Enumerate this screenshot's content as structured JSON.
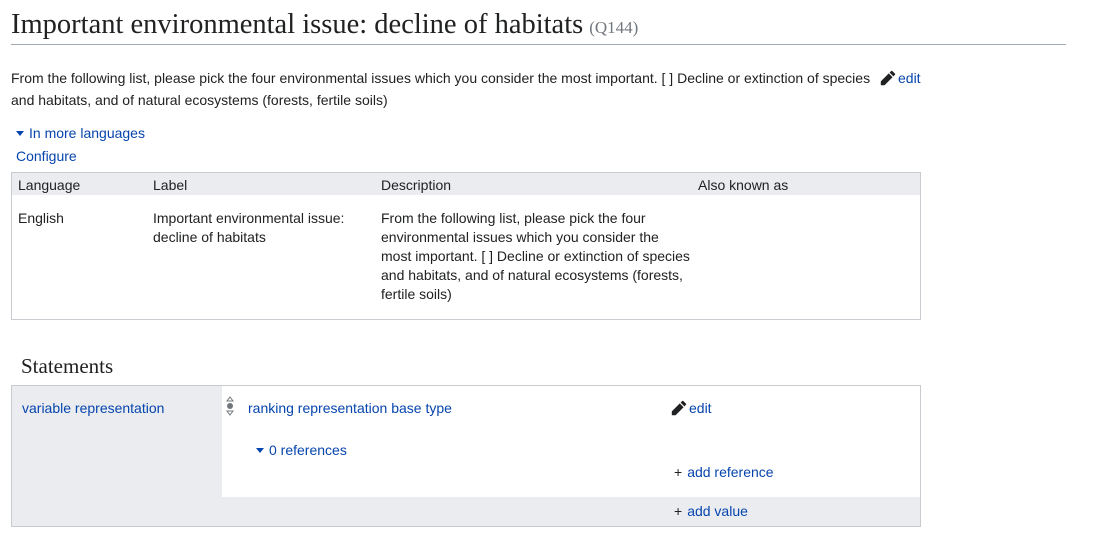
{
  "header": {
    "title": "Important environmental issue: decline of habitats",
    "id": "(Q144)"
  },
  "description": {
    "text": "From the following list, please pick the four environmental issues which you consider the most important. [ ] Decline or extinction of species and habitats, and of natural ecosystems (forests, fertile soils)",
    "edit_label": "edit"
  },
  "languages": {
    "toggle_label": "In more languages",
    "configure_label": "Configure",
    "columns": [
      "Language",
      "Label",
      "Description",
      "Also known as"
    ],
    "rows": [
      {
        "language": "English",
        "label": "Important environmental issue: decline of habitats",
        "description": "From the following list, please pick the four environmental issues which you consider the most important. [ ] Decline or extinction of species and habitats, and of natural ecosystems (forests, fertile soils)",
        "aliases": ""
      }
    ]
  },
  "statements": {
    "heading": "Statements",
    "items": [
      {
        "property": "variable representation",
        "value": "ranking representation base type",
        "edit_label": "edit",
        "references_label": "0 references",
        "add_reference_label": "add reference",
        "add_value_label": "add value"
      }
    ]
  },
  "colors": {
    "link": "#0645ad",
    "header_bg": "#eaecf0",
    "border": "#c8ccd1"
  },
  "icons": {
    "edit": "pencil-icon",
    "rank": "rank-selector-icon",
    "expand": "caret-down-icon",
    "add": "plus-icon"
  }
}
